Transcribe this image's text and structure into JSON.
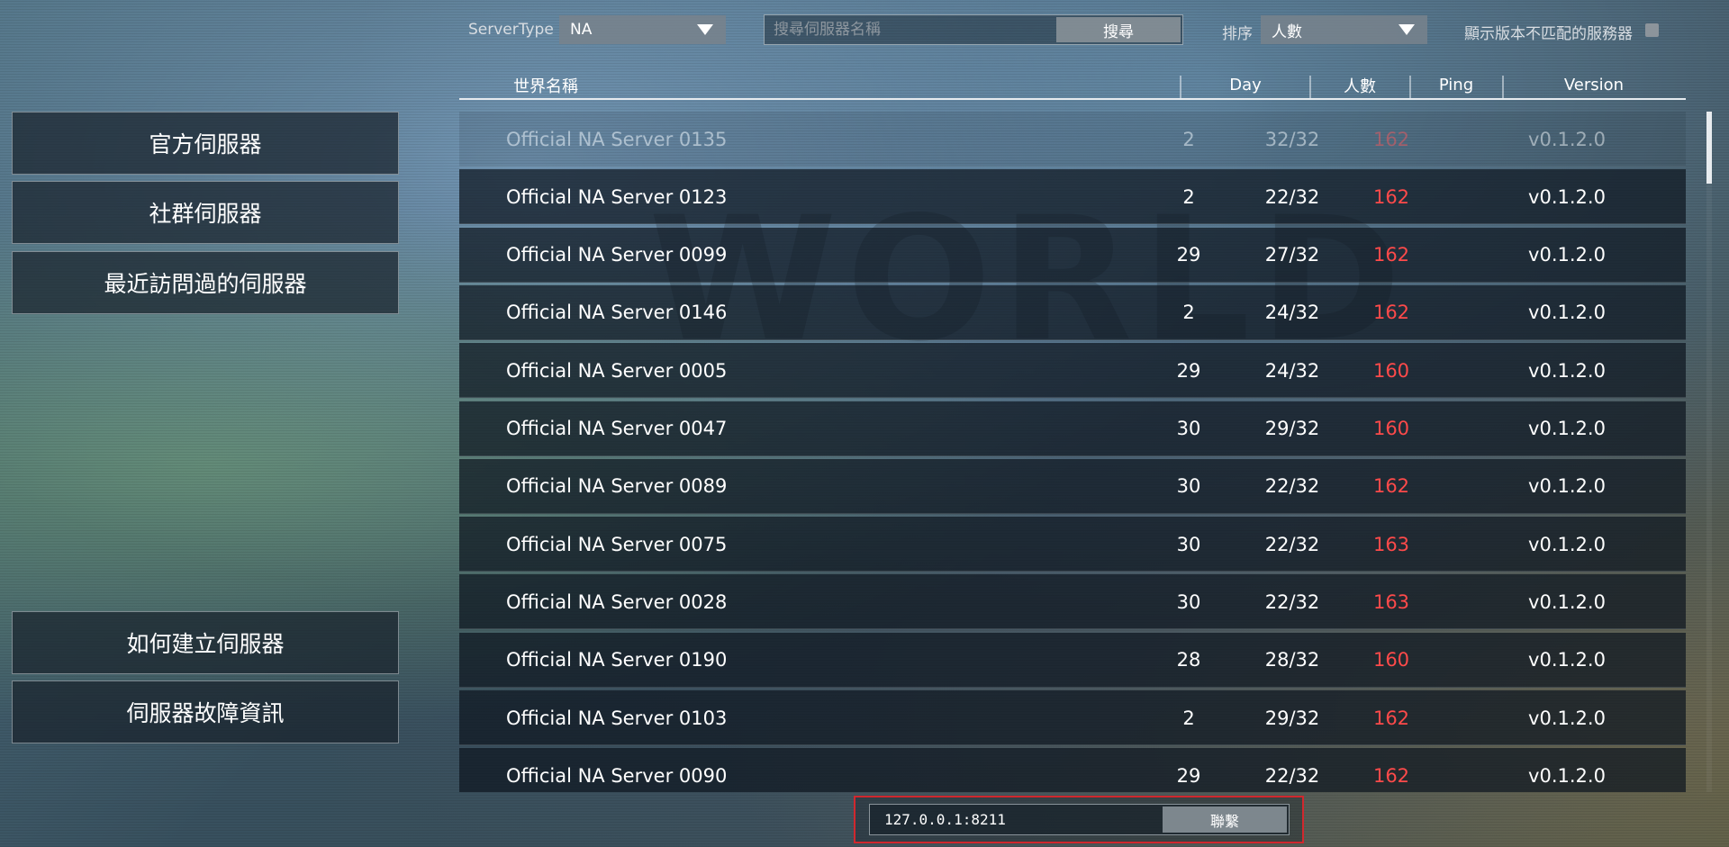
{
  "filters": {
    "server_type_label": "ServerType",
    "server_type_value": "NA",
    "search_placeholder": "搜尋伺服器名稱",
    "search_button": "搜尋",
    "sort_label": "排序",
    "sort_value": "人數",
    "show_mismatch_label": "顯示版本不匹配的服務器",
    "show_mismatch_checked": false
  },
  "menu": {
    "official": "官方伺服器",
    "community": "社群伺服器",
    "recent": "最近訪問過的伺服器",
    "how_to": "如何建立伺服器",
    "troubleshoot": "伺服器故障資訊"
  },
  "table": {
    "headers": {
      "name": "世界名稱",
      "day": "Day",
      "players": "人數",
      "ping": "Ping",
      "version": "Version"
    },
    "rows": [
      {
        "name": "Official NA Server 0135",
        "day": "2",
        "players": "32/32",
        "ping": "162",
        "version": "v0.1.2.0"
      },
      {
        "name": "Official NA Server 0123",
        "day": "2",
        "players": "22/32",
        "ping": "162",
        "version": "v0.1.2.0"
      },
      {
        "name": "Official NA Server 0099",
        "day": "29",
        "players": "27/32",
        "ping": "162",
        "version": "v0.1.2.0"
      },
      {
        "name": "Official NA Server 0146",
        "day": "2",
        "players": "24/32",
        "ping": "162",
        "version": "v0.1.2.0"
      },
      {
        "name": "Official NA Server 0005",
        "day": "29",
        "players": "24/32",
        "ping": "160",
        "version": "v0.1.2.0"
      },
      {
        "name": "Official NA Server 0047",
        "day": "30",
        "players": "29/32",
        "ping": "160",
        "version": "v0.1.2.0"
      },
      {
        "name": "Official NA Server 0089",
        "day": "30",
        "players": "22/32",
        "ping": "162",
        "version": "v0.1.2.0"
      },
      {
        "name": "Official NA Server 0075",
        "day": "30",
        "players": "22/32",
        "ping": "163",
        "version": "v0.1.2.0"
      },
      {
        "name": "Official NA Server 0028",
        "day": "30",
        "players": "22/32",
        "ping": "163",
        "version": "v0.1.2.0"
      },
      {
        "name": "Official NA Server 0190",
        "day": "28",
        "players": "28/32",
        "ping": "160",
        "version": "v0.1.2.0"
      },
      {
        "name": "Official NA Server 0103",
        "day": "2",
        "players": "29/32",
        "ping": "162",
        "version": "v0.1.2.0"
      },
      {
        "name": "Official NA Server 0090",
        "day": "29",
        "players": "22/32",
        "ping": "162",
        "version": "v0.1.2.0"
      }
    ]
  },
  "connect": {
    "address": "127.0.0.1:8211",
    "button": "聯繫"
  },
  "colors": {
    "ping_red": "#ff4a4a",
    "highlight_frame": "#d0282e"
  }
}
